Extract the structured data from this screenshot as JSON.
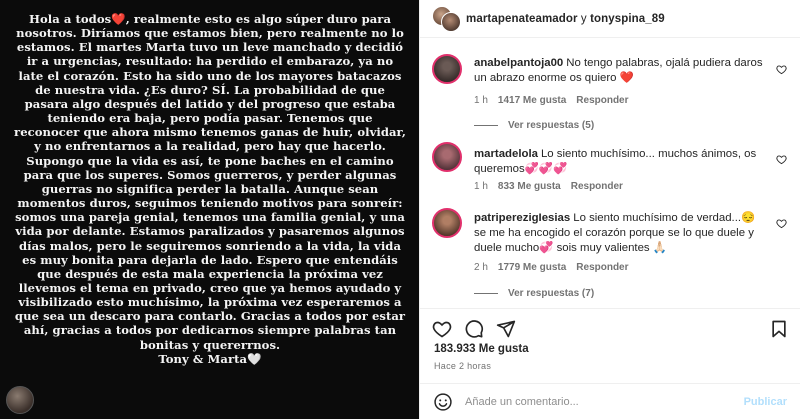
{
  "story": {
    "heart": "❤️",
    "lines": [
      "realmente esto es algo súper duro para nosotros. Diríamos que estamos bien, pero realmente no lo estamos. El martes Marta tuvo un leve manchado y decidió ir a urgencias, resultado: ha perdido el embarazo, ya no late el corazón. Esto ha sido uno de los mayores batacazos de nuestra vida. ¿Es duro? SÍ. La probabilidad de que pasara algo después del latido y del progreso que estaba teniendo era baja, pero podía pasar. Tenemos que reconocer que ahora mismo tenemos ganas de huir, olvidar, y no enfrentarnos a la realidad, pero hay que hacerlo. Supongo que la vida es así, te pone baches en el camino para que los superes. Somos guerreros, y perder algunas guerras no significa perder la batalla. Aunque sean momentos duros, seguimos teniendo motivos para sonreír: somos una pareja genial, tenemos una familia genial, y una vida por delante. Estamos paralizados y pasaremos algunos días malos, pero le seguiremos sonriendo a la vida, la vida es muy bonita para dejarla de lado. Espero que entendáis que después de esta mala experiencia la próxima vez llevemos el tema en privado, creo que ya hemos ayudado y visibilizado esto muchísimo, la próxima vez esperaremos a que sea un descaro para contarlo. Gracias a todos por estar ahí, gracias a todos por dedicarnos siempre palabras tan bonitas y quererrnos."
    ],
    "greeting": "Hola a todos",
    "signature": "Tony & Marta",
    "signature_heart": "🤍"
  },
  "header": {
    "user_primary": "martapenateamador",
    "connector": " y ",
    "user_secondary": "tonyspina_89"
  },
  "comments": [
    {
      "username": "anabelpantoja00",
      "text": "No tengo palabras, ojalá pudiera daros un abrazo enorme os quiero ❤️",
      "time": "1 h",
      "likes": "1417 Me gusta",
      "reply": "Responder",
      "view_replies": "Ver respuestas (5)"
    },
    {
      "username": "martadelola",
      "text": "Lo siento muchísimo... muchos ánimos, os queremos💞💞💞",
      "time": "1 h",
      "likes": "833 Me gusta",
      "reply": "Responder",
      "view_replies": ""
    },
    {
      "username": "patriperezigIesias",
      "text": "Lo siento muchísimo de verdad...😔 se me ha encogido el corazón porque se lo que duele y duele mucho💞 sois muy valientes 🙏🏻",
      "time": "2 h",
      "likes": "1779 Me gusta",
      "reply": "Responder",
      "view_replies": "Ver respuestas (7)"
    }
  ],
  "post": {
    "likes": "183.933 Me gusta",
    "time_ago": "Hace 2 horas"
  },
  "comment_box": {
    "placeholder": "Añade un comentario...",
    "publish": "Publicar"
  },
  "icons": {
    "like": "heart-outline-icon",
    "comment": "speech-bubble-icon",
    "share": "paper-plane-icon",
    "save": "bookmark-icon",
    "emoji": "smiley-icon"
  },
  "colors": {
    "accent": "#0095f6",
    "publish_disabled": "#b2dffc",
    "heart_red": "#e0245e",
    "story_bg": "#0b0b0b"
  }
}
